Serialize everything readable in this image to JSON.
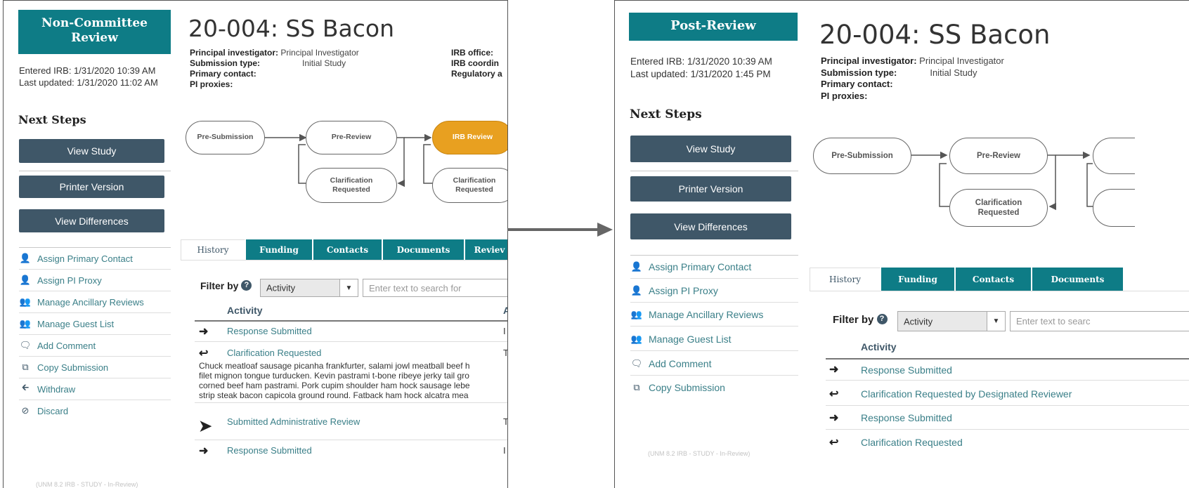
{
  "panel_before": {
    "state": "Non-Committee Review",
    "entered_irb": "Entered IRB: 1/31/2020 10:39 AM",
    "last_updated": "Last updated: 1/31/2020 11:02 AM",
    "next_steps": "Next Steps",
    "buttons": [
      "View Study",
      "Printer Version",
      "View Differences"
    ],
    "actions": [
      {
        "label": "Assign Primary Contact",
        "icon": "user-plus-icon"
      },
      {
        "label": "Assign PI Proxy",
        "icon": "user-plus-icon"
      },
      {
        "label": "Manage Ancillary Reviews",
        "icon": "users-icon"
      },
      {
        "label": "Manage Guest List",
        "icon": "users-icon"
      },
      {
        "label": "Add Comment",
        "icon": "comment-icon"
      },
      {
        "label": "Copy Submission",
        "icon": "copy-icon"
      },
      {
        "label": "Withdraw",
        "icon": "arrow-left-icon"
      },
      {
        "label": "Discard",
        "icon": "ban-icon"
      }
    ],
    "footer": "(UNM 8.2 IRB - STUDY - In-Review)",
    "title": "20-004: SS Bacon",
    "info": {
      "pi_label": "Principal investigator:",
      "pi_value": "Principal Investigator",
      "type_label": "Submission type:",
      "type_value": "Initial Study",
      "contact_label": "Primary contact:",
      "proxies_label": "PI proxies:",
      "office_label": "IRB office:",
      "coord_label": "IRB coordin",
      "reg_label": "Regulatory a"
    },
    "workflow": {
      "pre_submission": "Pre-Submission",
      "pre_review": "Pre-Review",
      "irb_review": "IRB Review",
      "clar1": "Clarification Requested",
      "clar2": "Clarification Requested"
    },
    "tabs": [
      "History",
      "Funding",
      "Contacts",
      "Documents",
      "Reviev"
    ],
    "filter_label": "Filter by",
    "filter_value": "Activity",
    "search_placeholder": "Enter text to search for",
    "col_activity": "Activity",
    "col_second": "A",
    "rows": [
      {
        "label": "Response Submitted",
        "tail": "I",
        "icon": "arrow-right-icon"
      },
      {
        "label": "Clarification Requested",
        "tail": "T",
        "icon": "reply-icon"
      },
      {
        "label": "Submitted Administrative Review",
        "tail": "T",
        "icon": "arrow-right-icon"
      },
      {
        "label": "Response Submitted",
        "tail": "I",
        "icon": "arrow-right-icon"
      }
    ],
    "comment_lines": [
      "Chuck meatloaf sausage picanha frankfurter, salami jowl meatball beef h",
      "filet mignon tongue turducken. Kevin pastrami t-bone ribeye jerky tail gro",
      "corned beef ham pastrami. Pork cupim shoulder ham hock sausage lebe",
      "strip steak bacon capicola ground round. Fatback ham hock alcatra mea"
    ]
  },
  "panel_after": {
    "state": "Post-Review",
    "entered_irb": "Entered IRB: 1/31/2020 10:39 AM",
    "last_updated": "Last updated: 1/31/2020 1:45 PM",
    "next_steps": "Next Steps",
    "buttons": [
      "View Study",
      "Printer Version",
      "View Differences"
    ],
    "actions": [
      {
        "label": "Assign Primary Contact",
        "icon": "user-plus-icon"
      },
      {
        "label": "Assign PI Proxy",
        "icon": "user-plus-icon"
      },
      {
        "label": "Manage Ancillary Reviews",
        "icon": "users-icon"
      },
      {
        "label": "Manage Guest List",
        "icon": "users-icon"
      },
      {
        "label": "Add Comment",
        "icon": "comment-icon"
      },
      {
        "label": "Copy Submission",
        "icon": "copy-icon"
      }
    ],
    "footer": "(UNM 8.2 IRB - STUDY - In-Review)",
    "title": "20-004: SS Bacon",
    "info": {
      "pi_label": "Principal investigator:",
      "pi_value": "Principal Investigator",
      "type_label": "Submission type:",
      "type_value": "Initial Study",
      "contact_label": "Primary contact:",
      "proxies_label": "PI proxies:"
    },
    "workflow": {
      "pre_submission": "Pre-Submission",
      "pre_review": "Pre-Review",
      "clar1": "Clarification Requested"
    },
    "tabs": [
      "History",
      "Funding",
      "Contacts",
      "Documents"
    ],
    "filter_label": "Filter by",
    "filter_value": "Activity",
    "search_placeholder": "Enter text to searc",
    "col_activity": "Activity",
    "rows": [
      {
        "label": "Response Submitted",
        "icon": "arrow-right-icon"
      },
      {
        "label": "Clarification Requested by Designated Reviewer",
        "icon": "reply-icon"
      },
      {
        "label": "Response Submitted",
        "icon": "arrow-right-icon"
      },
      {
        "label": "Clarification Requested",
        "icon": "reply-icon"
      }
    ]
  },
  "colors": {
    "teal": "#0e7c86",
    "button": "#3f5768",
    "active_step": "#e8a020"
  }
}
